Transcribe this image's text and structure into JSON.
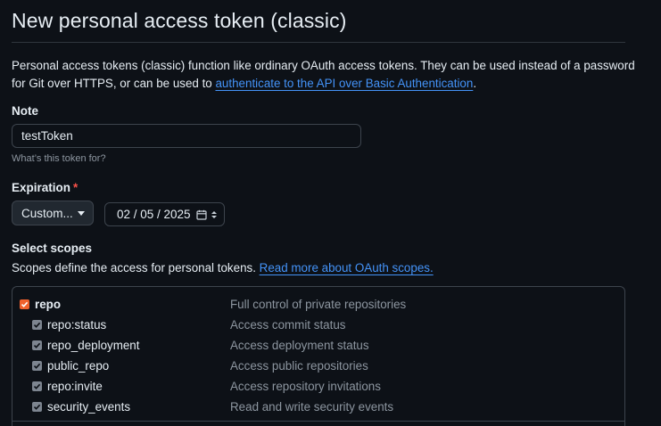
{
  "page_title": "New personal access token (classic)",
  "intro": {
    "text": "Personal access tokens (classic) function like ordinary OAuth access tokens. They can be used instead of a password for Git over HTTPS, or can be used to ",
    "link": "authenticate to the API over Basic Authentication",
    "suffix": "."
  },
  "note": {
    "label": "Note",
    "value": "testToken",
    "help": "What’s this token for?"
  },
  "expiration": {
    "label": "Expiration",
    "required_marker": "*",
    "select_value": "Custom...",
    "date_value": "02 / 05 / 2025"
  },
  "scopes": {
    "label": "Select scopes",
    "desc": "Scopes define the access for personal tokens. ",
    "link": "Read more about OAuth scopes.",
    "items": [
      {
        "name": "repo",
        "desc": "Full control of private repositories",
        "checked": true,
        "level": "parent"
      },
      {
        "name": "repo:status",
        "desc": "Access commit status",
        "checked": true,
        "level": "child"
      },
      {
        "name": "repo_deployment",
        "desc": "Access deployment status",
        "checked": true,
        "level": "child"
      },
      {
        "name": "public_repo",
        "desc": "Access public repositories",
        "checked": true,
        "level": "child"
      },
      {
        "name": "repo:invite",
        "desc": "Access repository invitations",
        "checked": true,
        "level": "child"
      },
      {
        "name": "security_events",
        "desc": "Read and write security events",
        "checked": true,
        "level": "child"
      }
    ]
  },
  "colors": {
    "background": "#0d1117",
    "link": "#4493f8",
    "checkbox_accent": "#f0622d",
    "required": "#f85149"
  }
}
